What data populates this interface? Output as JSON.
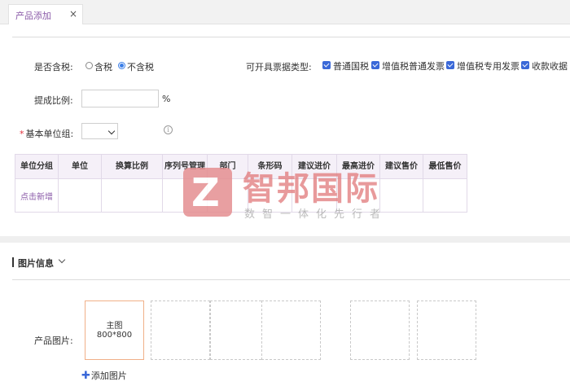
{
  "tabs": [
    {
      "label": "产品添加",
      "close": "×"
    }
  ],
  "tax": {
    "label": "是否含税:",
    "options": [
      "含税",
      "不含税"
    ],
    "selected": "不含税"
  },
  "invoice": {
    "label": "可开具票据类型:",
    "options": [
      "普通国税",
      "增值税普通发票",
      "增值税专用发票",
      "收款收据"
    ],
    "checked": [
      true,
      true,
      true,
      true
    ]
  },
  "commission": {
    "label": "提成比例:",
    "value": "",
    "unit": "%"
  },
  "base_unit_group": {
    "label": "基本单位组:",
    "required_mark": "*",
    "value": ""
  },
  "unit_table": {
    "headers": [
      "单位分组",
      "单位",
      "换算比例",
      "序列号管理",
      "部门",
      "条形码",
      "建议进价",
      "最高进价",
      "建议售价",
      "最低售价"
    ],
    "add_label": "点击新增"
  },
  "watermark": {
    "logo_letter": "Z",
    "title": "智邦国际",
    "subtitle": "数智一体化先行者"
  },
  "image_section": {
    "title": "图片信息"
  },
  "product_image": {
    "label": "产品图片:",
    "main_label": "主图",
    "main_size": "800*800",
    "add_label": "添加图片"
  },
  "colors": {
    "accent": "#8a5aa8",
    "checkbox": "#3a68d8",
    "watermark": "#e0787a",
    "required": "#e0303a"
  },
  "icons": [
    "close-icon",
    "info-icon",
    "chevron-down-icon",
    "plus-icon"
  ]
}
